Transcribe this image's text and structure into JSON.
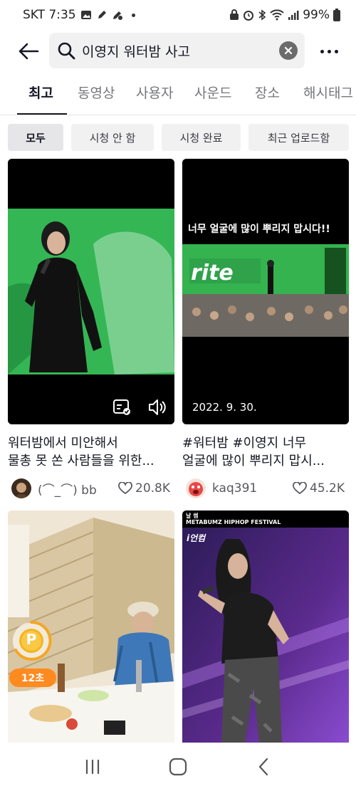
{
  "status_bar": {
    "carrier_time": "SKT 7:35",
    "battery": "99%"
  },
  "search": {
    "query": "이영지 워터밤 사고"
  },
  "tabs": [
    {
      "label": "최고"
    },
    {
      "label": "동영상"
    },
    {
      "label": "사용자"
    },
    {
      "label": "사운드"
    },
    {
      "label": "장소"
    },
    {
      "label": "해시태그"
    }
  ],
  "filters": [
    {
      "label": "모두"
    },
    {
      "label": "시청 안 함"
    },
    {
      "label": "시청 완료"
    },
    {
      "label": "최근 업로드함"
    }
  ],
  "videos": [
    {
      "title_line1": "워터밤에서 미안해서",
      "title_line2": "물총 못 쏜 사람들을 위한...",
      "username": "(⌒_⌒) bb",
      "likes": "20.8K"
    },
    {
      "overlay_top": "너무 얼굴에 많이 뿌리지 맙시다!!",
      "overlay_bottom": "2022. 9. 30.",
      "title_line1": "#워터밤 #이영지 너무",
      "title_line2": "얼굴에 많이 뿌리지 맙시...",
      "username": "kaq391",
      "likes": "45.2K"
    },
    {
      "timer_badge": "12초",
      "coin_label": "P"
    },
    {
      "festival_small": "날 썸",
      "festival_title": "METABUMZ HIPHOP FESTIVAL",
      "festival_logo": "i언컴"
    }
  ],
  "colors": {
    "accent_green": "#2aa84a",
    "badge_orange": "#ff8a1f",
    "coin_yellow": "#f5a623",
    "stage_purple": "#5a2a8c"
  }
}
